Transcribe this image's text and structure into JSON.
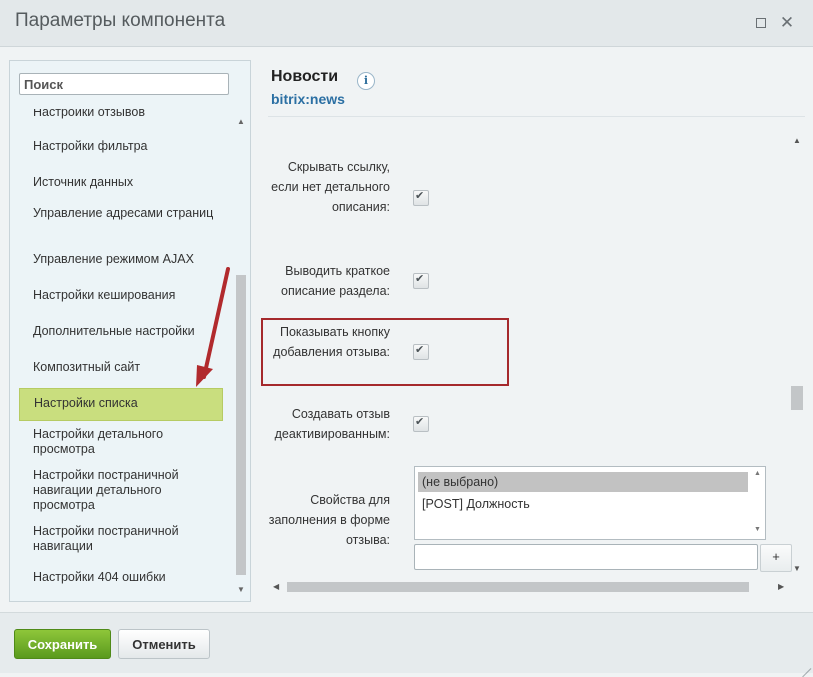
{
  "dialog": {
    "title": "Параметры компонента"
  },
  "sidebar": {
    "search_placeholder": "Поиск",
    "items": [
      {
        "label": "Настройки отзывов"
      },
      {
        "label": "Настройки фильтра"
      },
      {
        "label": "Источник данных"
      },
      {
        "label": "Управление адресами страниц"
      },
      {
        "label": "Управление режимом AJAX"
      },
      {
        "label": "Настройки кеширования"
      },
      {
        "label": "Дополнительные настройки"
      },
      {
        "label": "Композитный сайт"
      },
      {
        "label": "Настройки списка",
        "selected": true
      },
      {
        "label": "Настройки детального просмотра"
      },
      {
        "label": "Настройки постраничной навигации детального просмотра"
      },
      {
        "label": "Настройки постраничной навигации"
      },
      {
        "label": "Настройки 404 ошибки"
      }
    ]
  },
  "component": {
    "title": "Новости",
    "code": "bitrix:news",
    "info_glyph": "i"
  },
  "fields": [
    {
      "label": "Скрывать ссылку, если нет детального описания:",
      "checked": true
    },
    {
      "label": "Выводить краткое описание раздела:",
      "checked": true
    },
    {
      "label": "Показывать кнопку добавления отзыва:",
      "checked": true,
      "highlighted": true
    },
    {
      "label": "Создавать отзыв деактивированным:",
      "checked": true
    }
  ],
  "properties_field": {
    "label": "Свойства для заполнения в форме отзыва:",
    "options": [
      "(не выбрано)",
      "[POST] Должность"
    ],
    "selected_index": 0,
    "input_value": "",
    "add_label": "+"
  },
  "footer": {
    "save_label": "Сохранить",
    "cancel_label": "Отменить"
  },
  "colors": {
    "selected_item": "#c9de7e",
    "save_button": "#6aab25",
    "highlight_box": "#a5292c",
    "link_blue": "#2b6fa3"
  }
}
